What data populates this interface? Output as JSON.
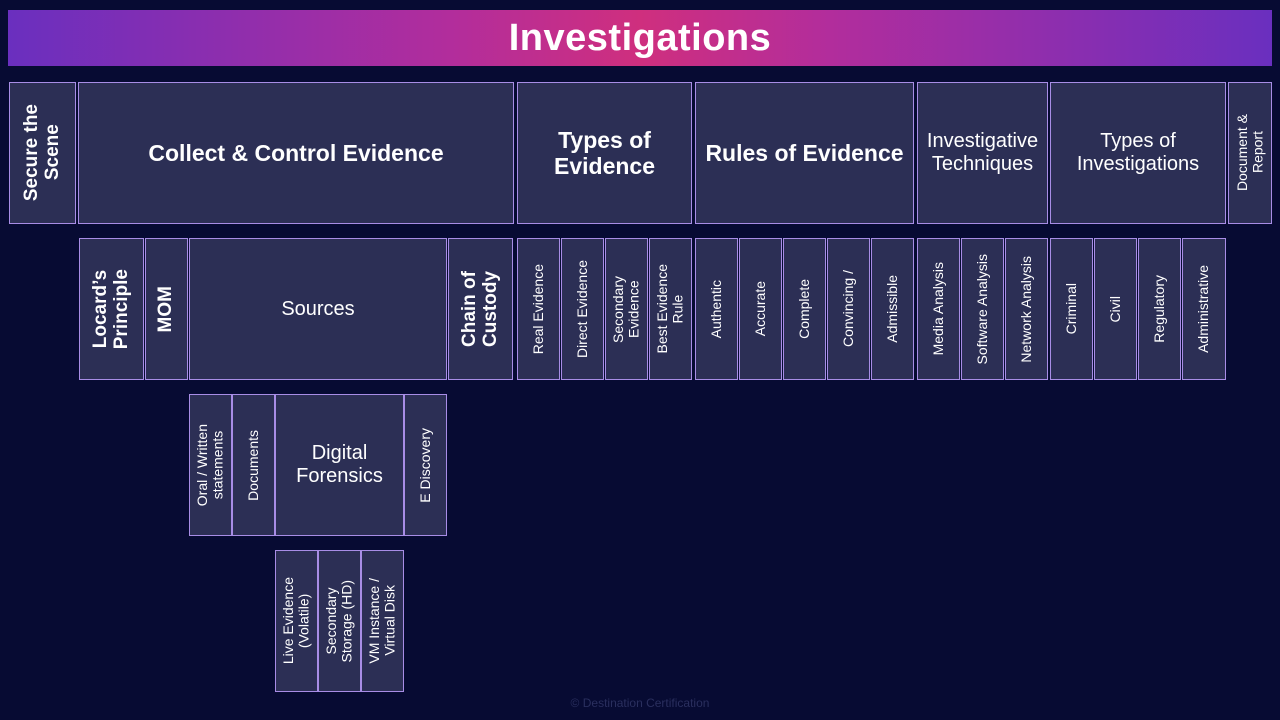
{
  "title": "Investigations",
  "phases": {
    "secure_scene": "Secure the\nScene",
    "collect_control": "Collect & Control Evidence",
    "types_of_evidence": "Types of Evidence",
    "rules_of_evidence": "Rules of Evidence",
    "investigative_techniques": "Investigative Techniques",
    "types_of_investigations": "Types of Investigations",
    "document_report": "Document &\nReport"
  },
  "collect": {
    "locards": "Locard’s\nPrinciple",
    "mom": "MOM",
    "sources": "Sources",
    "chain": "Chain of\nCustody"
  },
  "sources": {
    "oral": "Oral / Written\nstatements",
    "documents": "Documents",
    "digital": "Digital Forensics",
    "ediscovery": "E Discovery"
  },
  "digital": {
    "live": "Live Evidence\n(Volatile)",
    "secondary": "Secondary\nStorage (HD)",
    "vm": "VM Instance /\nVirtual Disk"
  },
  "evidence_types": {
    "real": "Real Evidence",
    "direct": "Direct Evidence",
    "secondary": "Secondary\nEvidence",
    "best": "Best Evidence\nRule"
  },
  "rules": {
    "authentic": "Authentic",
    "accurate": "Accurate",
    "complete": "Complete",
    "convincing": "Convincing /",
    "admissible": "Admissible"
  },
  "techniques": {
    "media": "Media Analysis",
    "software": "Software Analysis",
    "network": "Network Analysis"
  },
  "investigation_types": {
    "criminal": "Criminal",
    "civil": "Civil",
    "regulatory": "Regulatory",
    "administrative": "Administrative"
  },
  "footer": "© Destination Certification"
}
